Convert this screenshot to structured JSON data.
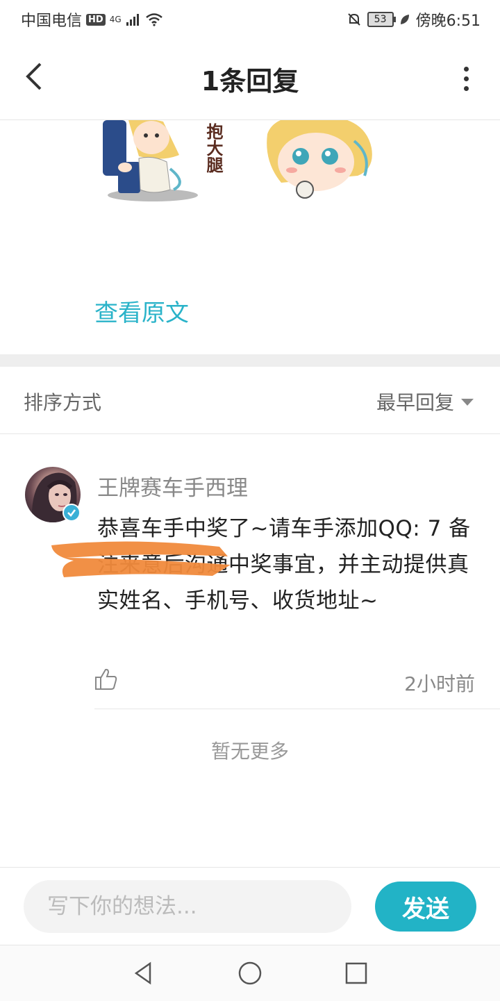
{
  "status_bar": {
    "carrier": "中国电信",
    "hd": "HD",
    "network": "4G",
    "battery": "53",
    "time": "傍晚6:51"
  },
  "header": {
    "title": "1条回复",
    "back_icon": "chevron-left-icon",
    "more_icon": "more-vertical-icon"
  },
  "original_post": {
    "sticker_text": "抱大腿",
    "view_original_label": "查看原文"
  },
  "sort": {
    "label": "排序方式",
    "value": "最早回复"
  },
  "reply": {
    "username": "王牌赛车手西理",
    "text": "恭喜车手中奖了~请车手添加QQ:                  7 备注来意后沟通中奖事宜，并主动提供真实姓名、手机号、收货地址~",
    "time": "2小时前"
  },
  "footer_note": "暂无更多",
  "input_bar": {
    "placeholder": "写下你的想法...",
    "send_label": "发送"
  },
  "colors": {
    "accent": "#22b3c6",
    "link": "#2ab3c9",
    "redaction": "#f08a3c"
  }
}
